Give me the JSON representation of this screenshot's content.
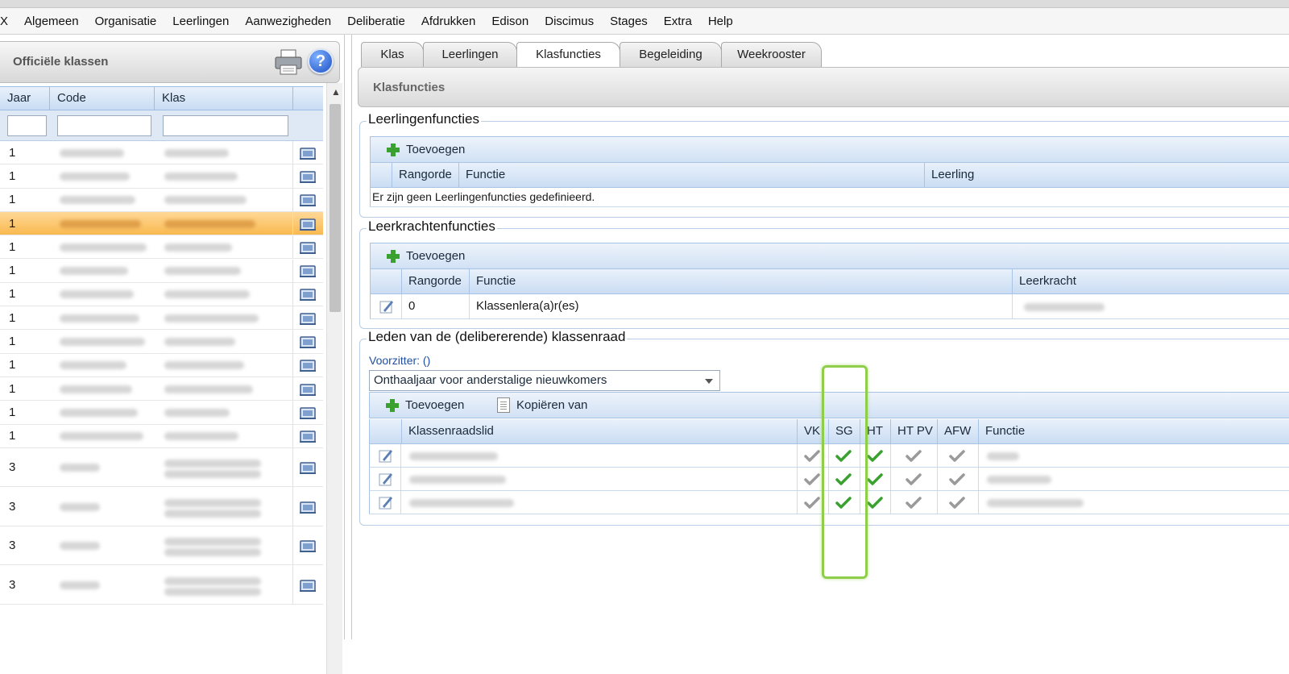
{
  "menu": [
    "X",
    "Algemeen",
    "Organisatie",
    "Leerlingen",
    "Aanwezigheden",
    "Deliberatie",
    "Afdrukken",
    "Edison",
    "Discimus",
    "Stages",
    "Extra",
    "Help"
  ],
  "left_panel": {
    "title": "Officiële klassen",
    "columns": [
      "Jaar",
      "Code",
      "Klas"
    ],
    "rows": [
      {
        "jaar": "1"
      },
      {
        "jaar": "1"
      },
      {
        "jaar": "1"
      },
      {
        "jaar": "1",
        "selected": true
      },
      {
        "jaar": "1"
      },
      {
        "jaar": "1"
      },
      {
        "jaar": "1"
      },
      {
        "jaar": "1"
      },
      {
        "jaar": "1"
      },
      {
        "jaar": "1"
      },
      {
        "jaar": "1"
      },
      {
        "jaar": "1"
      },
      {
        "jaar": "1"
      },
      {
        "jaar": "3"
      },
      {
        "jaar": "3"
      },
      {
        "jaar": "3"
      },
      {
        "jaar": "3"
      }
    ],
    "icons": {
      "print": "printer-icon",
      "help": "help-icon",
      "help_glyph": "?",
      "scroll_up": "▲"
    }
  },
  "tabs": [
    {
      "label": "Klas",
      "active": false
    },
    {
      "label": "Leerlingen",
      "active": false
    },
    {
      "label": "Klasfuncties",
      "active": true
    },
    {
      "label": "Begeleiding",
      "active": false
    },
    {
      "label": "Weekrooster",
      "active": false
    }
  ],
  "section_title": "Klasfuncties",
  "leerlingenfuncties": {
    "legend": "Leerlingenfuncties",
    "add_label": "Toevoegen",
    "columns": [
      "Rangorde",
      "Functie",
      "Leerling"
    ],
    "empty_text": "Er zijn geen Leerlingenfuncties gedefinieerd."
  },
  "leerkrachtenfuncties": {
    "legend": "Leerkrachtenfuncties",
    "add_label": "Toevoegen",
    "columns": [
      "Rangorde",
      "Functie",
      "Leerkracht"
    ],
    "rows": [
      {
        "rangorde": "0",
        "functie": "Klassenlera(a)r(es)"
      }
    ]
  },
  "klassenraad": {
    "legend": "Leden van de (delibererende) klassenraad",
    "voorzitter": "Voorzitter: ()",
    "selected_option": "Onthaaljaar voor anderstalige nieuwkomers",
    "add_label": "Toevoegen",
    "copy_label": "Kopiëren van",
    "columns": [
      "Klassenraadslid",
      "VK",
      "SG",
      "HT",
      "HT PV",
      "AFW",
      "Functie"
    ],
    "rows": [
      {
        "vk": false,
        "sg": true,
        "ht": true,
        "htpv": false,
        "afw": false
      },
      {
        "vk": false,
        "sg": true,
        "ht": true,
        "htpv": false,
        "afw": false
      },
      {
        "vk": false,
        "sg": true,
        "ht": true,
        "htpv": false,
        "afw": false
      }
    ]
  },
  "colors": {
    "accent_blue": "#c9dcf3",
    "selected_row": "#f9b950",
    "highlight": "#8fce4a",
    "check_green": "#3aa130",
    "check_grey": "#9a9a9a"
  }
}
